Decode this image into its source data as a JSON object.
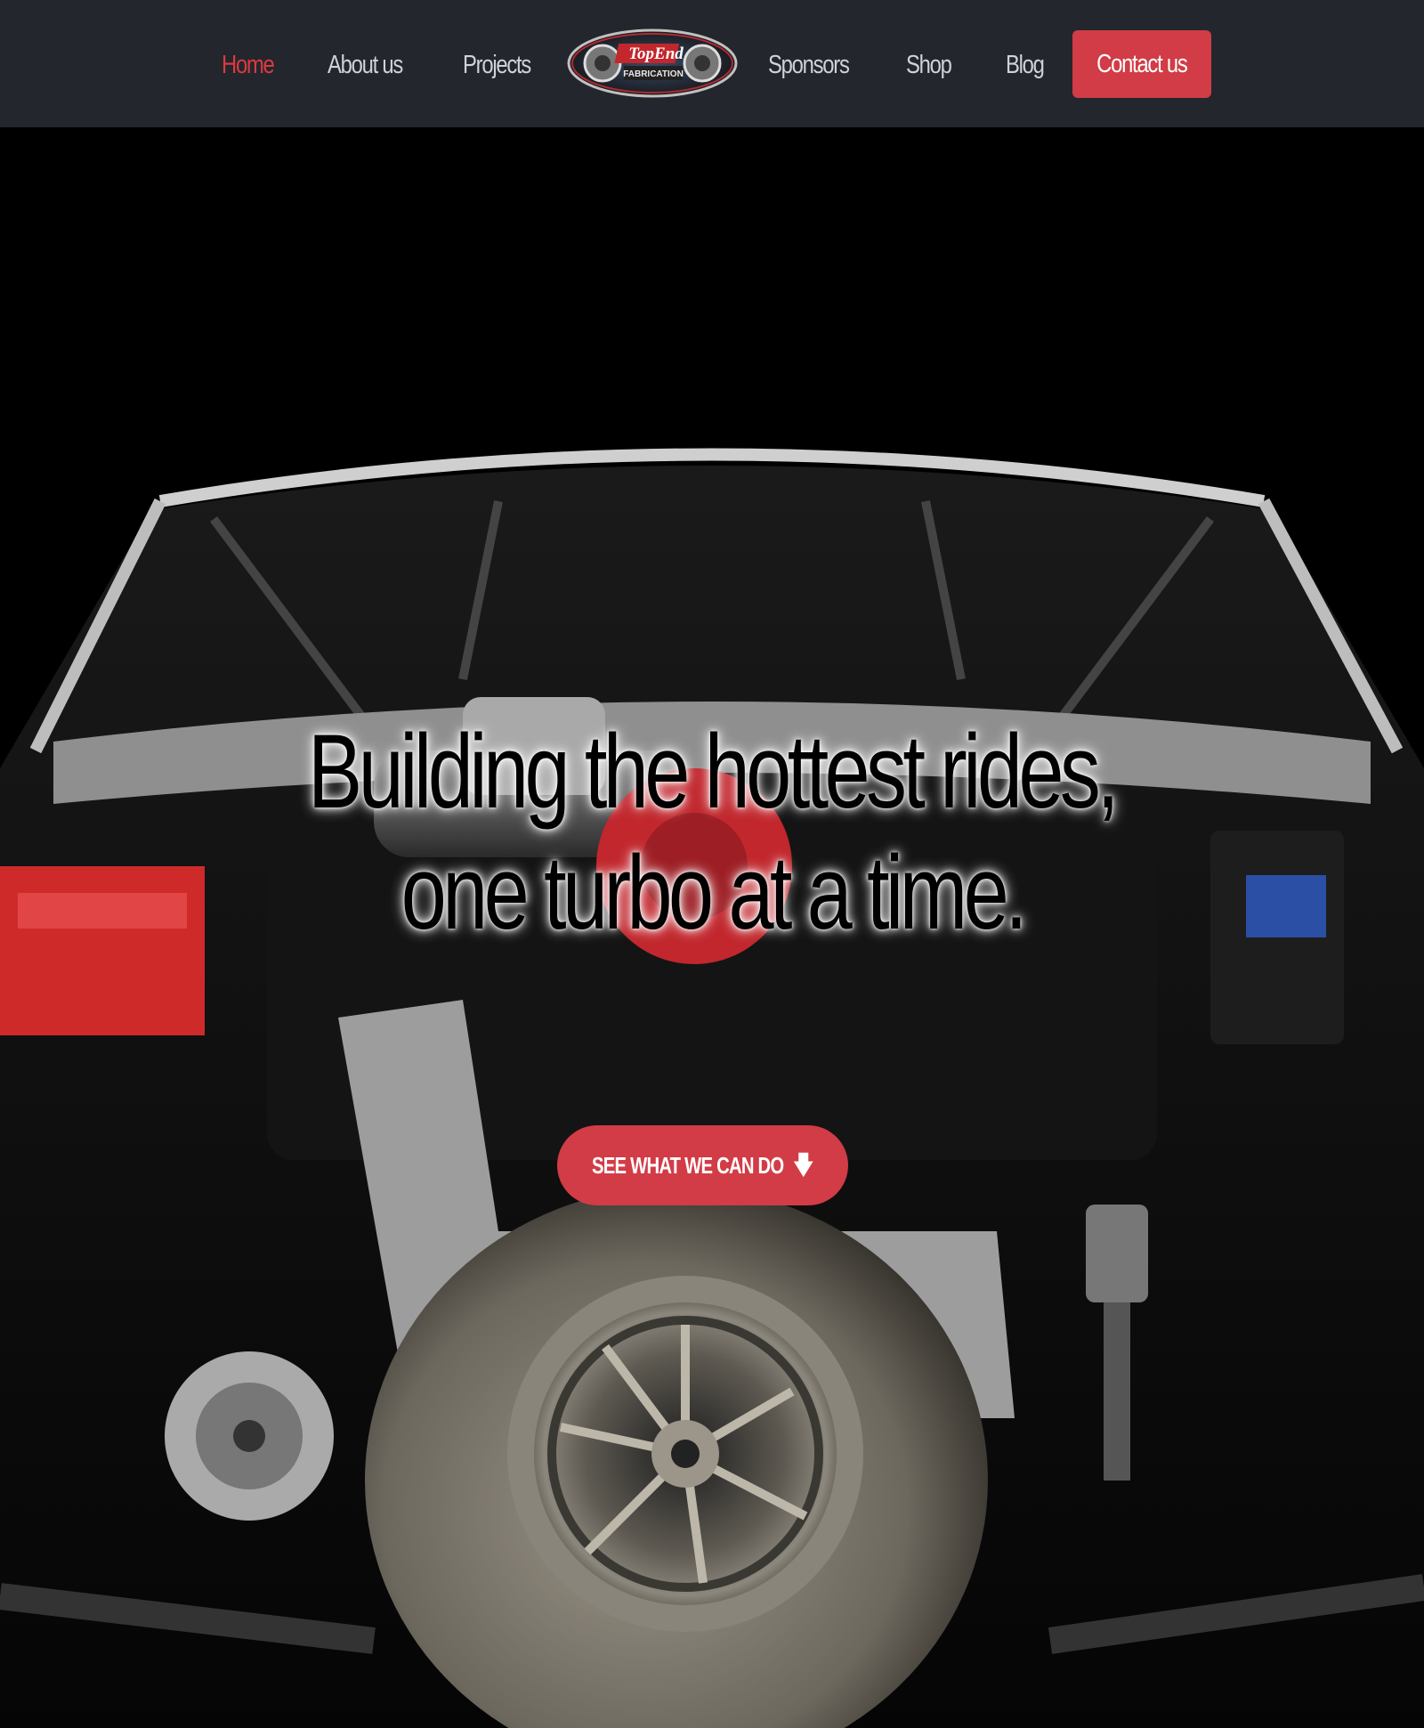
{
  "nav": {
    "left_items": [
      {
        "label": "Home",
        "active": true
      },
      {
        "label": "About us",
        "active": false
      },
      {
        "label": "Projects",
        "active": false
      }
    ],
    "right_items": [
      {
        "label": "Sponsors",
        "active": false
      },
      {
        "label": "Shop",
        "active": false
      },
      {
        "label": "Blog",
        "active": false
      }
    ],
    "contact_label": "Contact us",
    "logo_text": "TopEnd FABRICATION"
  },
  "hero": {
    "headline_line1": "Building the hottest rides,",
    "headline_line2": "one turbo at a time.",
    "cta_label": "SEE WHAT WE CAN DO",
    "cta_icon": "arrow-down-icon",
    "image_subject": "engine-bay-turbo-photo"
  },
  "colors": {
    "nav_bg": "#23262d",
    "accent": "#d13c46",
    "active_link": "#dc3a3f",
    "link": "#cfd2d6"
  }
}
